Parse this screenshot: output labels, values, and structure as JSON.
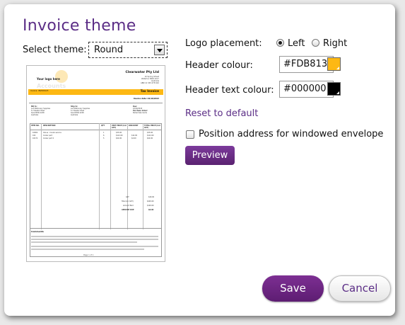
{
  "dialog": {
    "title": "Invoice theme",
    "select_theme_label": "Select theme:",
    "theme_value": "Round",
    "logo_placement_label": "Logo placement:",
    "logo_options": [
      {
        "label": "Left",
        "selected": true
      },
      {
        "label": "Right",
        "selected": false
      }
    ],
    "header_colour_label": "Header colour:",
    "header_colour_value": "#FDB813",
    "header_text_colour_label": "Header text colour:",
    "header_text_colour_value": "#000000",
    "reset_link": "Reset to default",
    "windowed_envelope_label": "Position address for windowed envelope",
    "windowed_envelope_checked": false,
    "preview_button": "Preview",
    "save_button": "Save",
    "cancel_button": "Cancel",
    "accent_color": "#5b2d86"
  },
  "invoice_preview": {
    "logo_text": "Your logo here",
    "accounts_text": "Accounts",
    "company_name": "Clearwater Pty Ltd",
    "company_address": [
      "10 Spring Street",
      "Waterloo NSW 2017",
      "Australia",
      "ABN 12 345 678 910"
    ],
    "band_left": "Invoice: INV000123",
    "band_right": "Tax Invoice",
    "due_line": "Invoice date: 22/10/2013",
    "bill_to": [
      "Bill to:",
      "A-Z Stationery Supplies",
      "5-7 Reader Road",
      "Sand NSW 2228",
      "Australia"
    ],
    "ship_to": [
      "Ship to:",
      "A-Z Stationery Supplies",
      "5-7 Reader Road",
      "Sand NSW 2228",
      "Australia"
    ],
    "meta": [
      "Due:",
      "22/10/2013",
      "Purchase Order:",
      "Nickel Sale Cards"
    ],
    "table_headers": [
      "ITEM NO.",
      "DESCRIPTION",
      "QTY",
      "UNIT PRICE (incl GST)",
      "DISCOUNT",
      "TOTAL PRICE (incl GST)"
    ],
    "rows": [
      [
        "10002",
        "Venue - Cooler service",
        "1",
        "$33.00",
        "",
        "$33.00"
      ],
      [
        "102",
        "Cooler part",
        "6",
        "$112.00",
        "$12.00",
        "$112.00"
      ],
      [
        "10172",
        "Cooler part 2",
        "5",
        "$22.00",
        "$2.00",
        "$22.00"
      ]
    ],
    "totals": [
      [
        "GST",
        "$20.00"
      ],
      [
        "Total (inc GST)",
        "$220.00"
      ],
      [
        "Amount Paid",
        "$120.00"
      ],
      [
        "AMOUNT DUE",
        "$0.00"
      ]
    ],
    "comments_label": "Comments",
    "page_footer": "Page 1 of 1"
  }
}
